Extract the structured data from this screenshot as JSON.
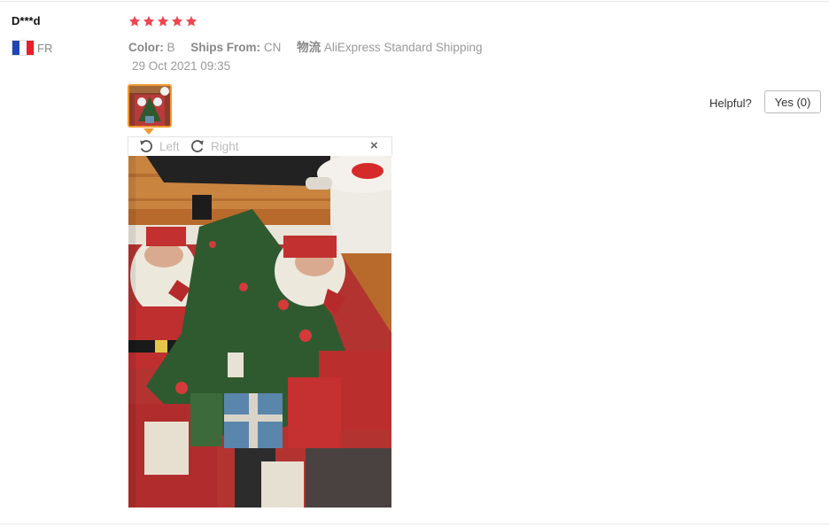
{
  "review": {
    "user_name": "D***d",
    "country_code": "FR",
    "rating": 5,
    "attributes": [
      {
        "label": "Color:",
        "value": "B"
      },
      {
        "label": "Ships From:",
        "value": "CN"
      },
      {
        "label": "物流",
        "value": "AliExpress Standard Shipping"
      }
    ],
    "date": "29 Oct 2021 09:35"
  },
  "helpful": {
    "label": "Helpful?",
    "button_label": "Yes (0)"
  },
  "viewer": {
    "rotate_left_label": "Left",
    "rotate_right_label": "Right",
    "close_symbol": "×"
  },
  "icons": {
    "star": "star-icon",
    "flag": "france-flag-icon",
    "rotate_left": "rotate-left-icon",
    "rotate_right": "rotate-right-icon",
    "close": "close-icon"
  },
  "colors": {
    "star": "#f0454f",
    "thumb_border": "#f09a34",
    "flag_blue": "#1f45b4",
    "flag_white": "#ffffff",
    "flag_red": "#e8202e"
  }
}
